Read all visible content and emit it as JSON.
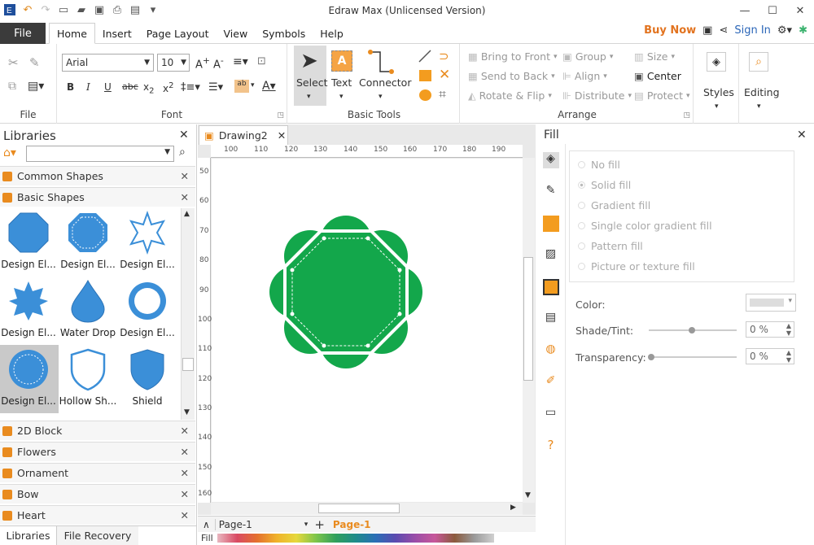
{
  "window": {
    "title": "Edraw Max (Unlicensed Version)"
  },
  "menu": {
    "file": "File",
    "tabs": [
      "Home",
      "Insert",
      "Page Layout",
      "View",
      "Symbols",
      "Help"
    ],
    "buy_now": "Buy Now",
    "sign_in": "Sign In"
  },
  "ribbon": {
    "file_group": "File",
    "font_group": "Font",
    "font_name": "Arial",
    "font_size": "10",
    "basic_tools_group": "Basic Tools",
    "select": "Select",
    "text": "Text",
    "connector": "Connector",
    "arrange_group": "Arrange",
    "bring_to_front": "Bring to Front",
    "send_to_back": "Send to Back",
    "rotate_flip": "Rotate & Flip",
    "group": "Group",
    "align": "Align",
    "distribute": "Distribute",
    "size": "Size",
    "center": "Center",
    "protect": "Protect",
    "styles": "Styles",
    "editing": "Editing"
  },
  "libraries": {
    "title": "Libraries",
    "items_top": [
      "Common Shapes",
      "Basic Shapes"
    ],
    "shapes": [
      "Design El...",
      "Design El...",
      "Design El...",
      "Design El...",
      "Water Drop",
      "Design El...",
      "Design El...",
      "Hollow Sh...",
      "Shield"
    ],
    "items_bottom": [
      "2D Block",
      "Flowers",
      "Ornament",
      "Bow",
      "Heart"
    ],
    "footer_tabs": [
      "Libraries",
      "File Recovery"
    ]
  },
  "document": {
    "tab": "Drawing2",
    "ruler_h": [
      "100",
      "110",
      "120",
      "130",
      "140",
      "150",
      "160",
      "170",
      "180",
      "190"
    ],
    "ruler_v": [
      "50",
      "60",
      "70",
      "80",
      "90",
      "100",
      "110",
      "120",
      "130",
      "140",
      "150",
      "160"
    ],
    "page_select": "Page-1",
    "page_tab": "Page-1",
    "fill_label": "Fill"
  },
  "fill_panel": {
    "title": "Fill",
    "options": [
      "No fill",
      "Solid fill",
      "Gradient fill",
      "Single color gradient fill",
      "Pattern fill",
      "Picture or texture fill"
    ],
    "selected_option": "Solid fill",
    "color_label": "Color:",
    "shade_label": "Shade/Tint:",
    "shade_value": "0 %",
    "transparency_label": "Transparency:",
    "transparency_value": "0 %"
  },
  "colors": {
    "shape_green": "#13a74b",
    "library_blue": "#3b8fd8",
    "accent_orange": "#e2731f"
  }
}
